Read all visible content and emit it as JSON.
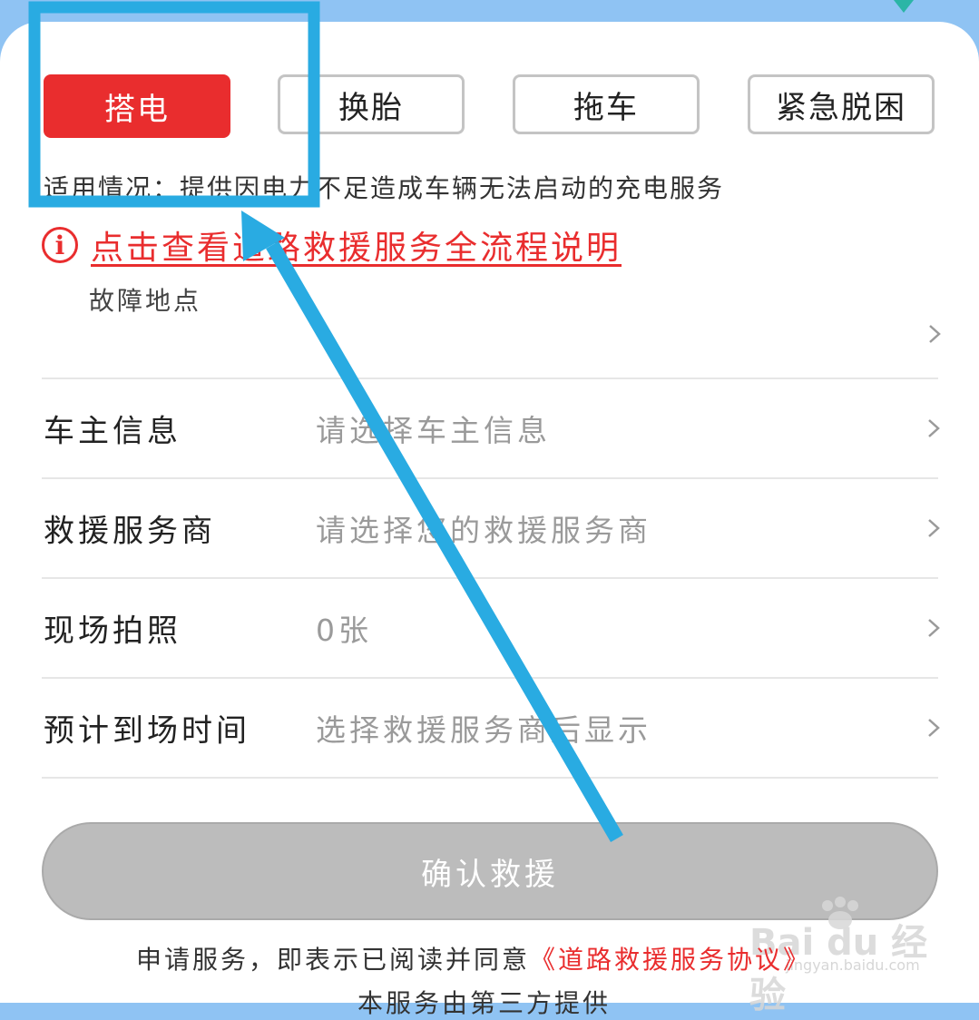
{
  "colors": {
    "accent": "#e92d2e",
    "annotation": "#29abe2",
    "disabled_button": "#bcbcbc"
  },
  "tabs": [
    {
      "label": "搭电",
      "active": true
    },
    {
      "label": "换胎",
      "active": false
    },
    {
      "label": "拖车",
      "active": false
    },
    {
      "label": "紧急脱困",
      "active": false
    }
  ],
  "scope_text": "适用情况：提供因电力不足造成车辆无法启动的充电服务",
  "flow_link": {
    "icon": "info-icon",
    "text": "点击查看道路救援服务全流程说明"
  },
  "fault_location": {
    "label": "故障地点",
    "icon": "chevron-right-icon"
  },
  "form_rows": [
    {
      "name": "owner-info",
      "label": "车主信息",
      "value": "请选择车主信息",
      "icon": "chevron-right-icon"
    },
    {
      "name": "rescue-provider",
      "label": "救援服务商",
      "value": "请选择您的救援服务商",
      "icon": "chevron-right-icon"
    },
    {
      "name": "site-photos",
      "label": "现场拍照",
      "value": "0张",
      "icon": "chevron-right-icon"
    },
    {
      "name": "eta",
      "label": "预计到场时间",
      "value": "选择救援服务商后显示",
      "icon": "chevron-right-icon"
    }
  ],
  "confirm_button": "确认救援",
  "agreement": {
    "prefix": "申请服务，即表示已阅读并同意",
    "link": "《道路救援服务协议》"
  },
  "provider_note": "本服务由第三方提供",
  "watermark": {
    "text": "Bai du 经验",
    "url": "jingyan.baidu.com"
  }
}
